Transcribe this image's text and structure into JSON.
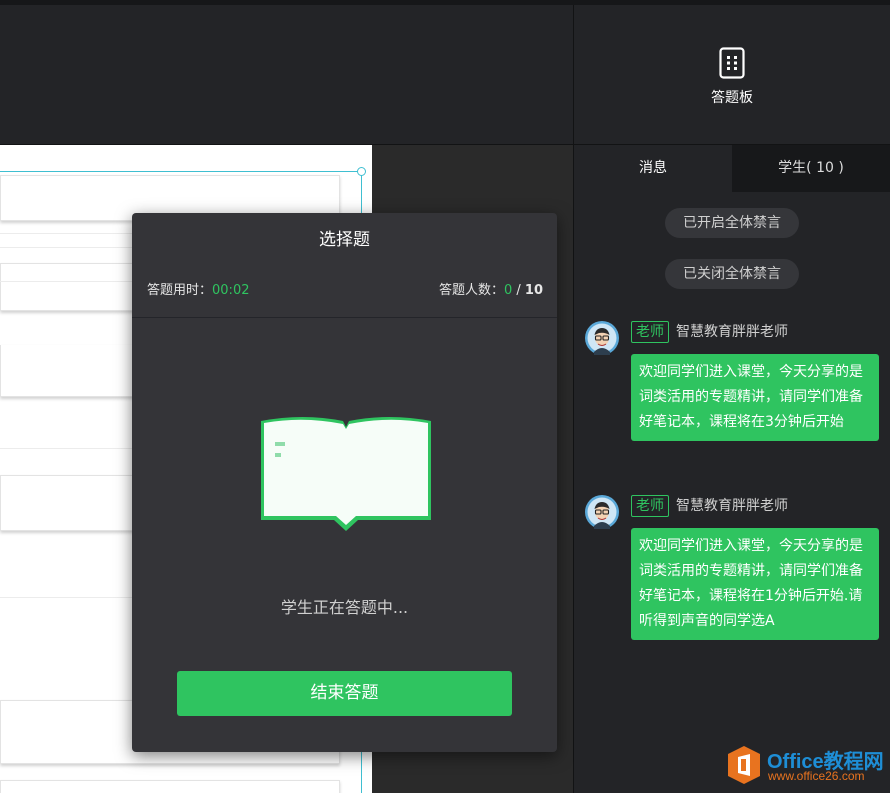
{
  "toolbar": {
    "answer_board_label": "答题板",
    "answer_board_icon": "answer-sheet-icon"
  },
  "modal": {
    "title": "选择题",
    "time_label": "答题用时：",
    "time_value": "00:02",
    "count_label": "答题人数：",
    "count_answered": "0",
    "count_separator": " / ",
    "count_total": "10",
    "illustration_icon": "open-book-icon",
    "status_text": "学生正在答题中...",
    "end_button_label": "结束答题"
  },
  "panel": {
    "tabs": [
      {
        "label": "消息",
        "active": true
      },
      {
        "label": "学生( 10 )",
        "active": false
      }
    ],
    "system_notices": [
      "已开启全体禁言",
      "已关闭全体禁言"
    ],
    "messages": [
      {
        "role": "老师",
        "sender": "智慧教育胖胖老师",
        "text": "欢迎同学们进入课堂，今天分享的是词类活用的专题精讲，请同学们准备好笔记本，课程将在3分钟后开始"
      },
      {
        "role": "老师",
        "sender": "智慧教育胖胖老师",
        "text": "欢迎同学们进入课堂，今天分享的是词类活用的专题精讲，请同学们准备好笔记本，课程将在1分钟后开始.请听得到声音的同学选A"
      }
    ]
  },
  "watermark": {
    "brand": "Office教程网",
    "url": "www.office26.com"
  },
  "colors": {
    "accent_green": "#2fc460",
    "panel_bg": "#232427",
    "modal_bg": "#343438"
  }
}
